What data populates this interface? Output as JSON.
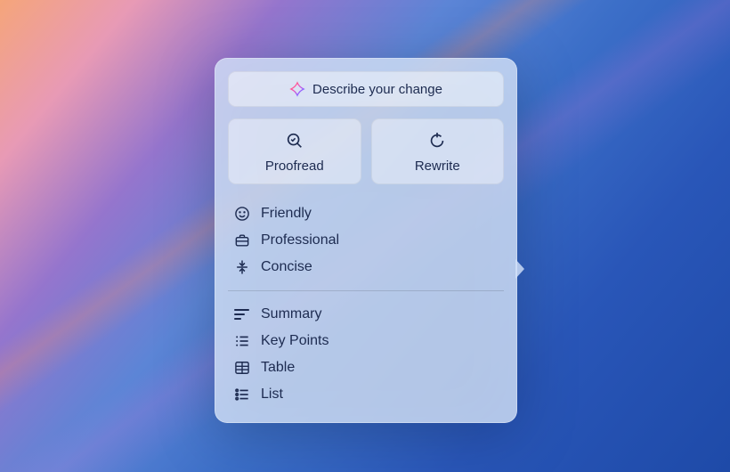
{
  "describe": {
    "label": "Describe your change"
  },
  "actions": {
    "proofread": {
      "label": "Proofread"
    },
    "rewrite": {
      "label": "Rewrite"
    }
  },
  "tones": {
    "friendly": {
      "label": "Friendly"
    },
    "professional": {
      "label": "Professional"
    },
    "concise": {
      "label": "Concise"
    }
  },
  "formats": {
    "summary": {
      "label": "Summary"
    },
    "keypoints": {
      "label": "Key Points"
    },
    "table": {
      "label": "Table"
    },
    "list": {
      "label": "List"
    }
  }
}
